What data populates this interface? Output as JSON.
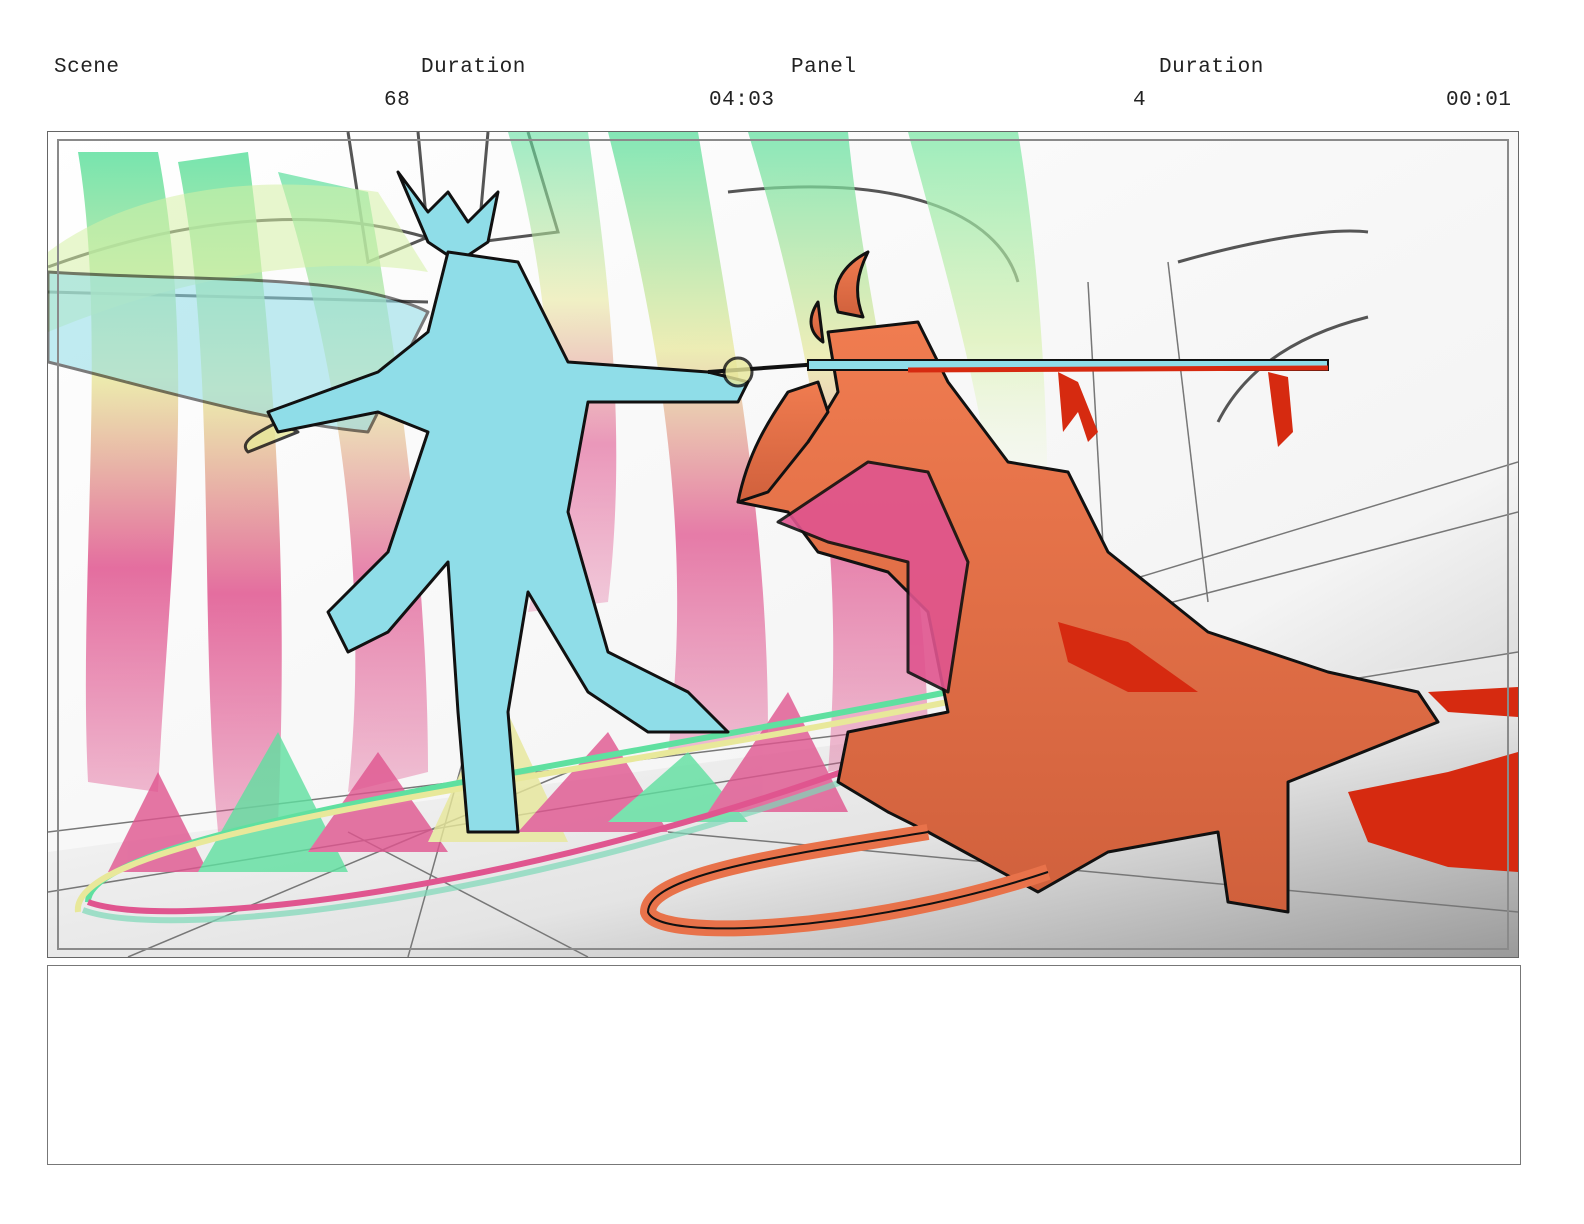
{
  "header": {
    "scene_label": "Scene",
    "scene_duration_label": "Duration",
    "panel_label": "Panel",
    "panel_duration_label": "Duration",
    "scene_number": "68",
    "scene_duration": "04:03",
    "panel_number": "4",
    "panel_duration": "00:01"
  },
  "panel": {
    "description_icon": "storyboard-sketch",
    "colors": {
      "cyan_figure": "#8fdde8",
      "orange_figure": "#e8724a",
      "blood_red": "#d62a10",
      "magenta": "#e0558f",
      "green": "#5fe0a0",
      "yellow": "#e8e89a"
    }
  },
  "notes": {
    "text": ""
  }
}
